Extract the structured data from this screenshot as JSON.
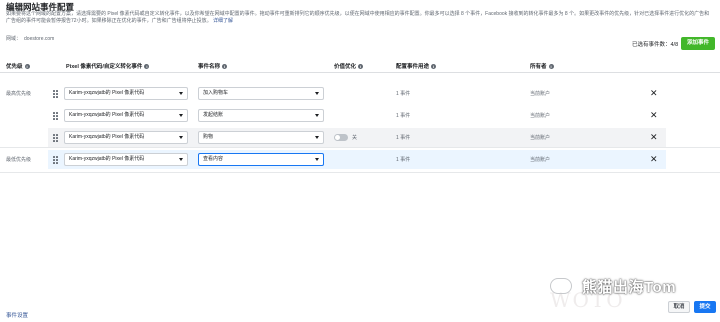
{
  "page": {
    "title": "编辑网站事件配置",
    "description": "如果要将这个网域的配置方案，请选择需要的 Pixel 像素代码或自定义转化事件，以及你希望在网域中配置的事件。拖动事件可重新排列它的顺序优先级，以便在网域中使用相应的事件配置。你最多可以选择 8 个事件，Facebook 接收到的转化事件最多为 8 个。如果更改事件的优先级，针对已选择事件进行优化的广告和广告组的事件可能会暂停报告72小时。如果移除正在优化的事件，广告和广告组将停止投放。",
    "learn_more": "详细了解"
  },
  "domain": {
    "label": "网域：",
    "value": "doestore.com"
  },
  "toolbar": {
    "selected_count": "已选有事件数：4/8",
    "add_event_label": "添加事件"
  },
  "columns": {
    "priority": "优先级",
    "pixel": "Pixel 像素代码/自定义转化事件",
    "event_name": "事件名称",
    "value_optimization": "价值优化",
    "configured_event_uses": "配置事件用途",
    "owner": "所有者"
  },
  "groups": {
    "highest": "最高优先级",
    "lowest": "最低优先级"
  },
  "rows": [
    {
      "pixel": "Karim-yxqzwjatb的 Pixel 像素代码",
      "event": "加入购物车",
      "uses": "1 事件",
      "owner": "当前账户"
    },
    {
      "pixel": "Karim-yxqzwjatb的 Pixel 像素代码",
      "event": "发起结账",
      "uses": "1 事件",
      "owner": "当前账户"
    },
    {
      "pixel": "Karim-yxqzwjatb的 Pixel 像素代码",
      "event": "购物",
      "value_toggle_label": "关",
      "uses": "1 事件",
      "owner": "当前账户"
    },
    {
      "pixel": "Karim-yxqzwjatb的 Pixel 像素代码",
      "event": "查看内容",
      "uses": "1 事件",
      "owner": "当前账户"
    }
  ],
  "footer": {
    "bottom_link": "事件设置",
    "cancel_label": "取消",
    "submit_label": "提交"
  },
  "watermark": {
    "text": "熊猫出海Tom",
    "faded_text": "WOTO"
  },
  "colors": {
    "primary_blue": "#1877f2",
    "add_button_green": "#42b72a",
    "row_highlight": "#ebf5ff",
    "row_shaded": "#f2f3f5"
  }
}
